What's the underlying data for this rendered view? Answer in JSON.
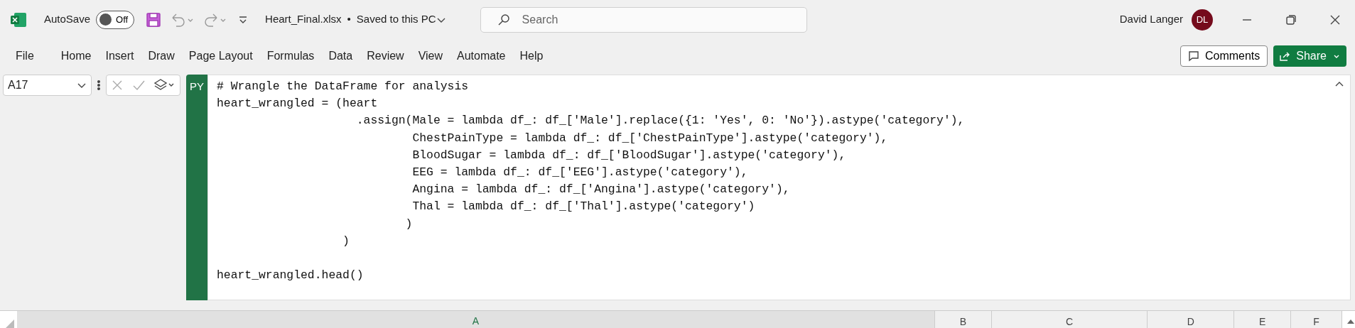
{
  "title_bar": {
    "autosave_label": "AutoSave",
    "autosave": {
      "on": false,
      "label": "Off"
    },
    "file_name": "Heart_Final.xlsx",
    "separator": "•",
    "save_status": "Saved to this PC",
    "search": {
      "placeholder": "Search"
    },
    "user_name": "David Langer",
    "avatar_initials": "DL"
  },
  "ribbon": {
    "tabs": [
      {
        "label": "File",
        "selected": false
      },
      {
        "label": "Home",
        "selected": false
      },
      {
        "label": "Insert",
        "selected": false
      },
      {
        "label": "Draw",
        "selected": false
      },
      {
        "label": "Page Layout",
        "selected": false
      },
      {
        "label": "Formulas",
        "selected": false
      },
      {
        "label": "Data",
        "selected": false
      },
      {
        "label": "Review",
        "selected": false
      },
      {
        "label": "View",
        "selected": false
      },
      {
        "label": "Automate",
        "selected": false
      },
      {
        "label": "Help",
        "selected": false
      }
    ],
    "comments_button": "Comments",
    "share_button": "Share"
  },
  "formula_bar": {
    "name_box": "A17",
    "cell_badge": "PY",
    "code": "# Wrangle the DataFrame for analysis\nheart_wrangled = (heart\n                    .assign(Male = lambda df_: df_['Male'].replace({1: 'Yes', 0: 'No'}).astype('category'),\n                            ChestPainType = lambda df_: df_['ChestPainType'].astype('category'),\n                            BloodSugar = lambda df_: df_['BloodSugar'].astype('category'),\n                            EEG = lambda df_: df_['EEG'].astype('category'),\n                            Angina = lambda df_: df_['Angina'].astype('category'),\n                            Thal = lambda df_: df_['Thal'].astype('category')\n                           )\n                  )\n\nheart_wrangled.head()"
  },
  "columns": [
    {
      "label": "A",
      "selected": true
    },
    {
      "label": "B",
      "selected": false
    },
    {
      "label": "C",
      "selected": false
    },
    {
      "label": "D",
      "selected": false
    },
    {
      "label": "E",
      "selected": false
    },
    {
      "label": "F",
      "selected": false
    }
  ]
}
